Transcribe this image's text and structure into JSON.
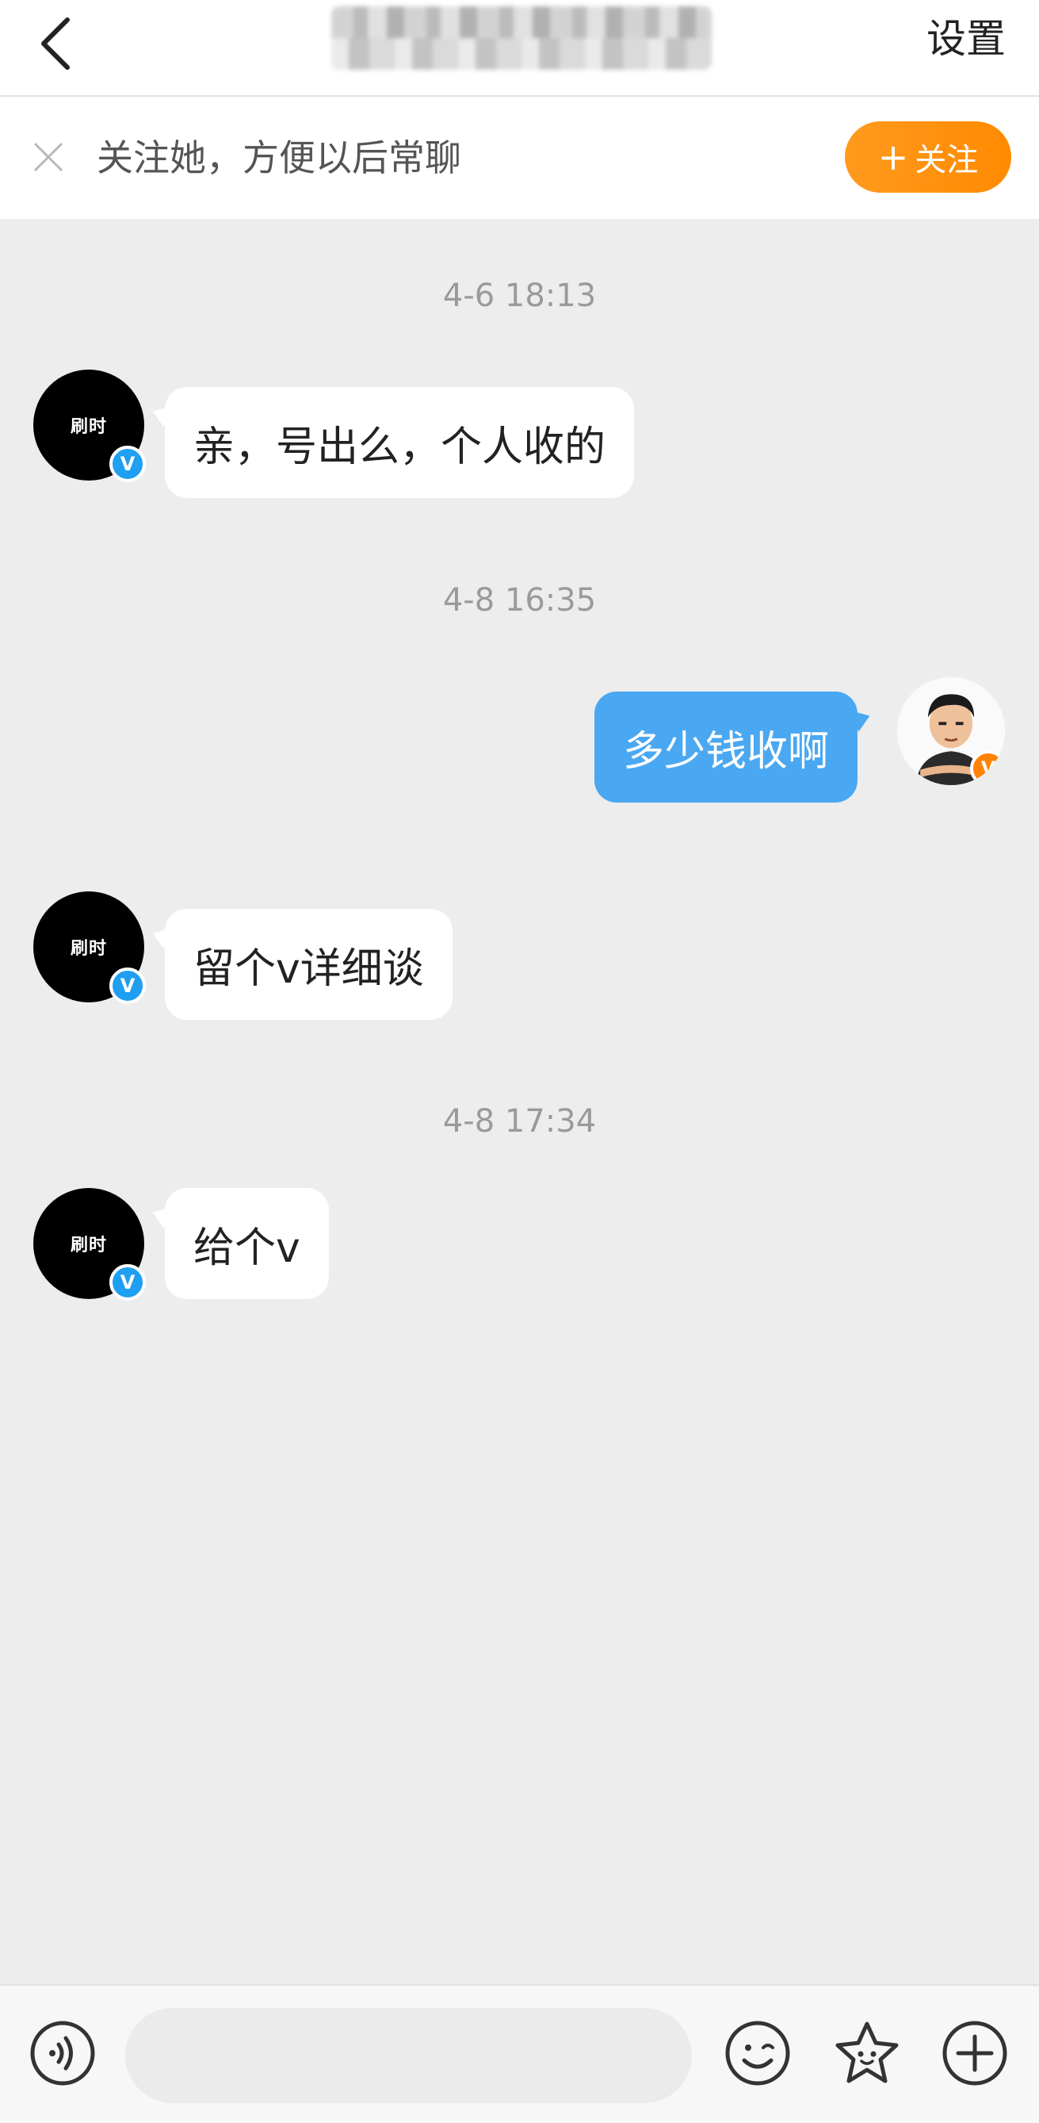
{
  "header": {
    "title_blurred": "",
    "settings_label": "设置"
  },
  "follow_bar": {
    "text": "关注她，方便以后常聊",
    "button_plus": "+",
    "button_label": "关注"
  },
  "messages": [
    {
      "timestamp": "4-6 18:13"
    },
    {
      "sender": "other",
      "avatar_label": "刷时",
      "text": "亲，号出么，个人收的"
    },
    {
      "timestamp": "4-8 16:35"
    },
    {
      "sender": "me",
      "text": "多少钱收啊"
    },
    {
      "sender": "other",
      "avatar_label": "刷时",
      "text": "留个v详细谈"
    },
    {
      "timestamp": "4-8 17:34"
    },
    {
      "sender": "other",
      "avatar_label": "刷时",
      "text": "给个v"
    }
  ],
  "badges": {
    "verified_blue": "V",
    "verified_orange": "V"
  },
  "colors": {
    "accent_orange": "#ff8a00",
    "my_bubble": "#4aa8f2",
    "verified_blue": "#1e9ff2",
    "background": "#ededed"
  },
  "input_bar": {
    "placeholder": "",
    "icons": [
      "voice-icon",
      "emoji-icon",
      "sticker-icon",
      "add-icon"
    ]
  }
}
